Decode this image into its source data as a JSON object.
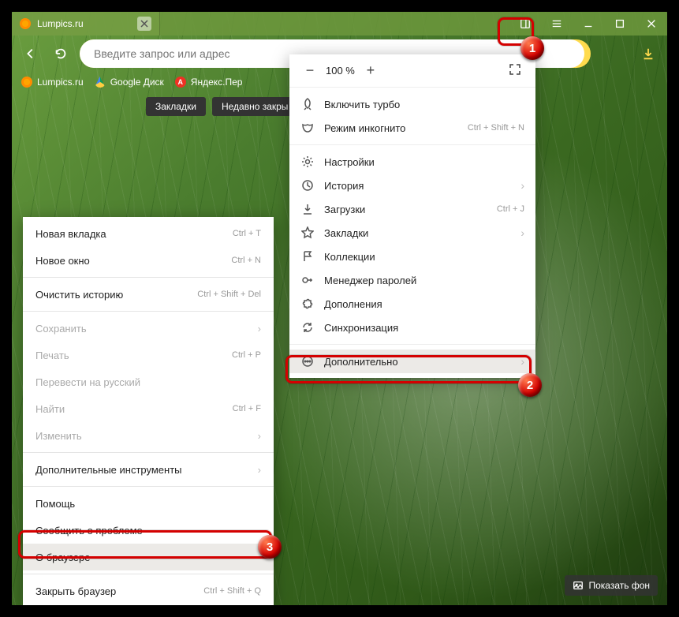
{
  "tab": {
    "title": "Lumpics.ru"
  },
  "address_placeholder": "Введите запрос или адрес",
  "bookmarks": [
    {
      "label": "Lumpics.ru"
    },
    {
      "label": "Google Диск"
    },
    {
      "label": "Яндекс.Пер"
    }
  ],
  "chips": {
    "bookmarks": "Закладки",
    "recent": "Недавно закры"
  },
  "zoom": {
    "value": "100 %"
  },
  "main_menu": {
    "turbo": "Включить турбо",
    "incognito": "Режим инкогнито",
    "incognito_sc": "Ctrl + Shift + N",
    "settings": "Настройки",
    "history": "История",
    "downloads": "Загрузки",
    "downloads_sc": "Ctrl + J",
    "bookmarks": "Закладки",
    "collections": "Коллекции",
    "passwords": "Менеджер паролей",
    "addons": "Дополнения",
    "sync": "Синхронизация",
    "more": "Дополнительно"
  },
  "sub_menu": {
    "new_tab": "Новая вкладка",
    "new_tab_sc": "Ctrl + T",
    "new_window": "Новое окно",
    "new_window_sc": "Ctrl + N",
    "clear_history": "Очистить историю",
    "clear_history_sc": "Ctrl + Shift + Del",
    "save": "Сохранить",
    "print": "Печать",
    "print_sc": "Ctrl + P",
    "translate": "Перевести на русский",
    "find": "Найти",
    "find_sc": "Ctrl + F",
    "edit": "Изменить",
    "dev_tools": "Дополнительные инструменты",
    "help": "Помощь",
    "report": "Сообщить о проблеме",
    "about": "О браузере",
    "quit": "Закрыть браузер",
    "quit_sc": "Ctrl + Shift + Q"
  },
  "show_bg": "Показать фон",
  "badges": {
    "b1": "1",
    "b2": "2",
    "b3": "3"
  }
}
